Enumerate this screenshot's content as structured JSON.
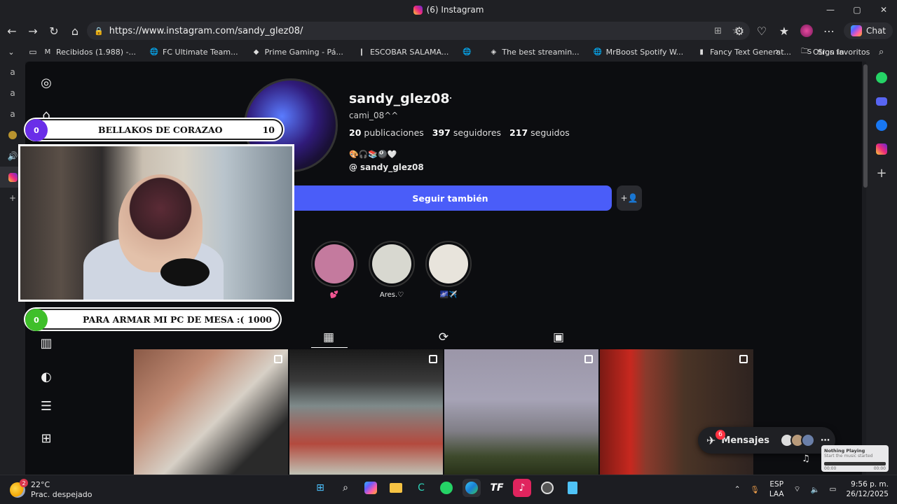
{
  "window": {
    "title": "(6) Instagram",
    "min": "—",
    "max": "▢",
    "close": "✕"
  },
  "browser": {
    "url": "https://www.instagram.com/sandy_glez08/",
    "chat_label": "Chat",
    "favorites": [
      {
        "label": "Recibidos (1.988) -...",
        "icon": "gmail-icon"
      },
      {
        "label": "FC Ultimate Team...",
        "icon": "globe-icon"
      },
      {
        "label": "Prime Gaming - Pá...",
        "icon": "prime-icon"
      },
      {
        "label": "ESCOBAR SALAMA...",
        "icon": "bookmark-icon"
      },
      {
        "label": "",
        "icon": "globe-icon"
      },
      {
        "label": "The best streamin...",
        "icon": "stream-icon"
      },
      {
        "label": "MrBoost Spotify W...",
        "icon": "globe-icon"
      },
      {
        "label": "Fancy Text Generat...",
        "icon": "text-icon"
      },
      {
        "label": "Sign in",
        "icon": "sat-icon"
      }
    ],
    "other_favorites": "Otros favoritos"
  },
  "profile": {
    "username": "sandy_glez08",
    "full_name": "cami_08^^",
    "posts_count": "20",
    "posts_label": "publicaciones",
    "followers_count": "397",
    "followers_label": "seguidores",
    "following_count": "217",
    "following_label": "seguidos",
    "bio_emoji": "🎨🎧📚🎱🤍",
    "threads_handle": "sandy_glez08",
    "follow_button": "Seguir también",
    "highlights": [
      {
        "label": "💕",
        "color": "#c47a9e"
      },
      {
        "label": "Ares.♡",
        "color": "#d8d8d0"
      },
      {
        "label": "🌌✈️",
        "color": "#e8e4dc"
      }
    ]
  },
  "overlays": {
    "goal1": {
      "count": "0",
      "title": "BELLAKOS DE CORAZAO",
      "target": "10",
      "color": "#6a2ee8"
    },
    "goal2": {
      "count": "0",
      "title": "PARA ARMAR MI PC DE MESA :(",
      "target": "1000",
      "color": "#3fbf2a"
    }
  },
  "messages": {
    "label": "Mensajes",
    "badge": "6"
  },
  "mini_player": {
    "title": "Nothing Playing",
    "subtitle": "Start the music started",
    "time_left": "00:00",
    "time_right": "00:00"
  },
  "taskbar": {
    "weather_temp": "22°C",
    "weather_desc": "Prac. despejado",
    "weather_badge": "2",
    "lang1": "ESP",
    "lang2": "LAA",
    "time": "9:56 p. m.",
    "date": "26/12/2025"
  }
}
